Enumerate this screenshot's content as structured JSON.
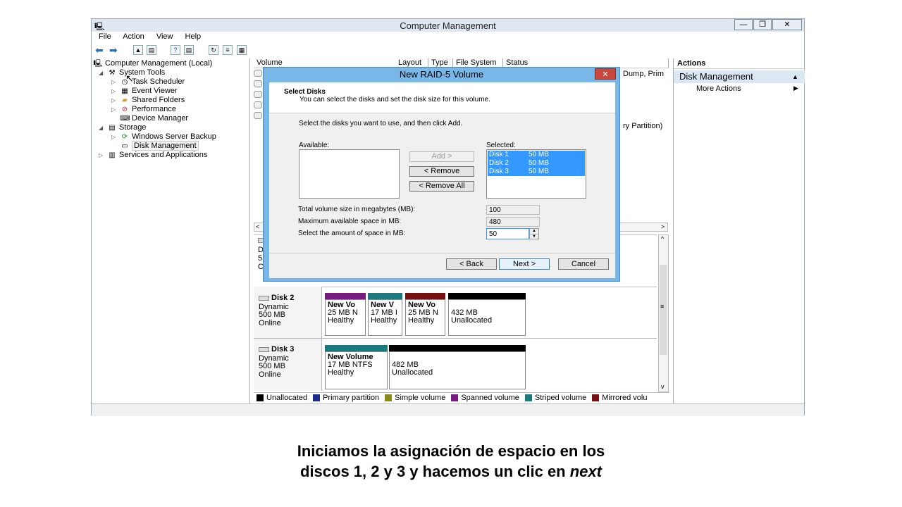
{
  "window": {
    "title": "Computer Management",
    "min_label": "—",
    "max_label": "❐",
    "close_label": "✕"
  },
  "menu": [
    "File",
    "Action",
    "View",
    "Help"
  ],
  "tree": {
    "root": "Computer Management (Local)",
    "system_tools": "System Tools",
    "task_scheduler": "Task Scheduler",
    "event_viewer": "Event Viewer",
    "shared_folders": "Shared Folders",
    "performance": "Performance",
    "device_manager": "Device Manager",
    "storage": "Storage",
    "windows_server_backup": "Windows Server Backup",
    "disk_management": "Disk Management",
    "services_apps": "Services and Applications"
  },
  "columns": {
    "volume": "Volume",
    "layout": "Layout",
    "type": "Type",
    "file_system": "File System",
    "status": "Status"
  },
  "status_fragments": [
    "Dump, Prim",
    "ry Partition)"
  ],
  "actions": {
    "header": "Actions",
    "section": "Disk Management",
    "more": "More Actions"
  },
  "disks": [
    {
      "name": "Disk 2",
      "type": "Dynamic",
      "size": "500 MB",
      "state": "Online",
      "parts": [
        {
          "line1": "New Vo",
          "line2": "25 MB N",
          "line3": "Healthy",
          "color": "#7a1a82"
        },
        {
          "line1": "New V",
          "line2": "17 MB I",
          "line3": "Healthy",
          "color": "#1a7b7f"
        },
        {
          "line1": "New Vo",
          "line2": "25 MB N",
          "line3": "Healthy",
          "color": "#7a0f12"
        },
        {
          "line1": "",
          "line2": "432 MB",
          "line3": "Unallocated",
          "color": "#000000"
        }
      ]
    },
    {
      "name": "Disk 3",
      "type": "Dynamic",
      "size": "500 MB",
      "state": "Online",
      "parts": [
        {
          "line1": "New Volume",
          "line2": "17 MB NTFS",
          "line3": "Healthy",
          "color": "#1a7b7f"
        },
        {
          "line1": "",
          "line2": "482 MB",
          "line3": "Unallocated",
          "color": "#000000"
        }
      ]
    }
  ],
  "partial_disk_letters": [
    "D",
    "5",
    "C"
  ],
  "legend": [
    {
      "label": "Unallocated",
      "color": "#000000"
    },
    {
      "label": "Primary partition",
      "color": "#1b2d8f"
    },
    {
      "label": "Simple volume",
      "color": "#8a8a1a"
    },
    {
      "label": "Spanned volume",
      "color": "#7a1a82"
    },
    {
      "label": "Striped volume",
      "color": "#1a7b7f"
    },
    {
      "label": "Mirrored volu",
      "color": "#7a0f12"
    }
  ],
  "dialog": {
    "title": "New RAID-5 Volume",
    "close_label": "✕",
    "heading": "Select Disks",
    "subheading": "You can select the disks and set the disk size for this volume.",
    "instruction": "Select the disks you want to use, and then click Add.",
    "available_label": "Available:",
    "selected_label": "Selected:",
    "selected_disks": [
      {
        "disk": "Disk 1",
        "size": "50 MB"
      },
      {
        "disk": "Disk 2",
        "size": "50 MB"
      },
      {
        "disk": "Disk 3",
        "size": "50 MB"
      }
    ],
    "add_button": "Add >",
    "remove_button": "< Remove",
    "remove_all_button": "< Remove All",
    "total_label": "Total volume size in megabytes (MB):",
    "total_value": "100",
    "max_label": "Maximum available space in MB:",
    "max_value": "480",
    "amount_label": "Select the amount of space in MB:",
    "amount_value": "50",
    "back_button": "< Back",
    "next_button": "Next >",
    "cancel_button": "Cancel"
  },
  "caption": {
    "line1": "Iniciamos la asignación de espacio en los",
    "line2_start": "discos 1, 2 y 3 y hacemos un clic en ",
    "line2_emph": "next"
  }
}
